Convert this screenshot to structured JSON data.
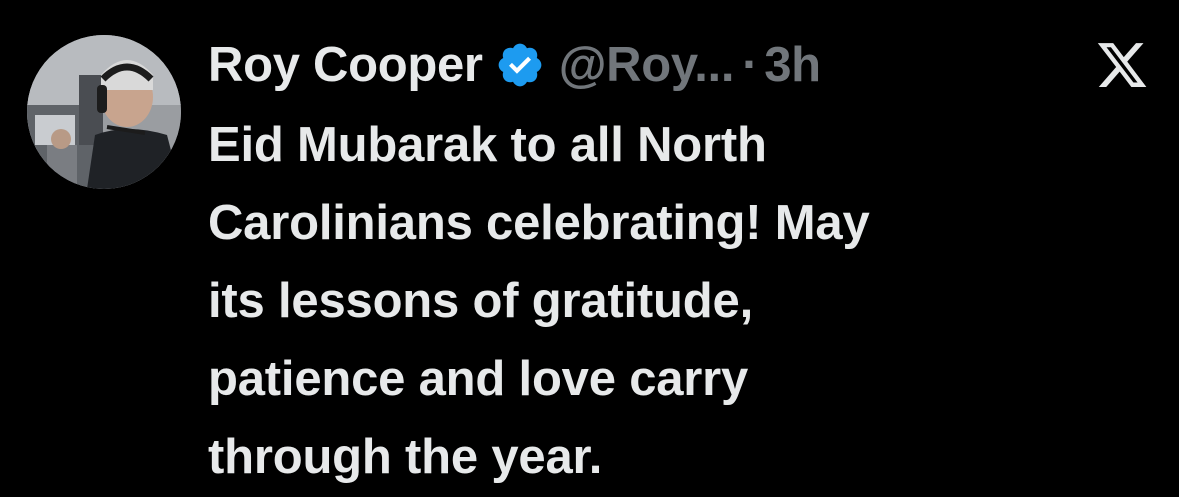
{
  "tweet": {
    "author": {
      "display_name": "Roy Cooper",
      "verified_icon": "verified-badge-icon",
      "handle": "@Roy...",
      "avatar_icon": "profile-photo"
    },
    "separator": "·",
    "timestamp": "3h",
    "brand_icon": "x-logo-icon",
    "text_lines": [
      "Eid Mubarak to all North",
      "Carolinians celebrating! May",
      "its lessons of gratitude,",
      "patience and love carry",
      "through the year."
    ]
  },
  "colors": {
    "background": "#000000",
    "primary_text": "#e7e9ea",
    "secondary_text": "#71767b",
    "verified_blue": "#1d9bf0"
  }
}
